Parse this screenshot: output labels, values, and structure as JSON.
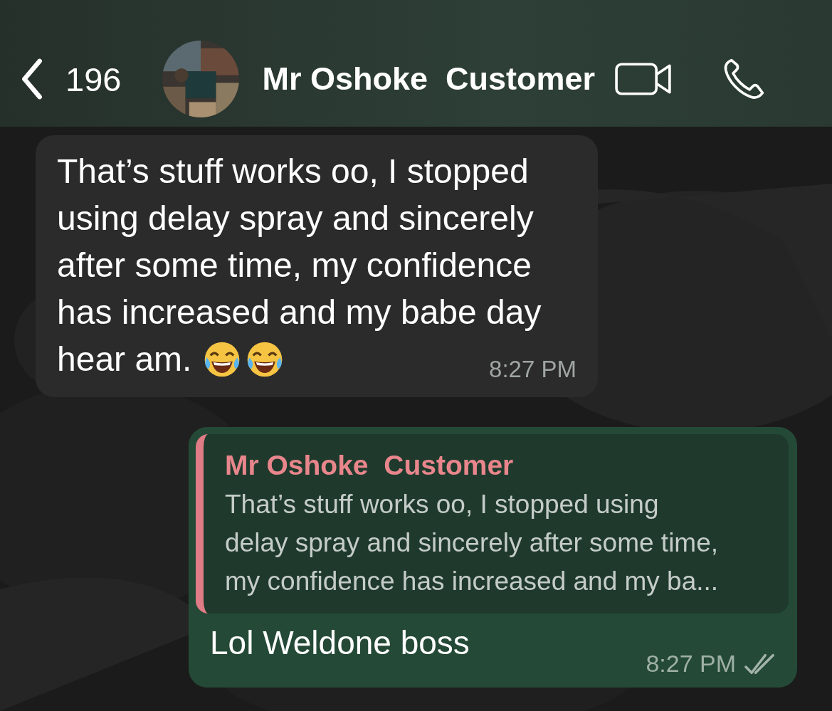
{
  "header": {
    "back_count": "196",
    "contact_name": "Mr Oshoke  Customer"
  },
  "messages": [
    {
      "kind": "incoming",
      "lines": [
        "That’s stuff works oo, I stopped",
        "using delay spray and sincerely",
        "after some time, my confidence",
        "has increased and my babe day",
        "hear am."
      ],
      "time": "8:27 PM"
    },
    {
      "kind": "outgoing",
      "quote": {
        "author": "Mr Oshoke  Customer",
        "lines": [
          "That’s stuff works oo, I stopped using",
          "delay spray and sincerely after some time,",
          "my confidence has increased and my ba..."
        ]
      },
      "text": "Lol Weldone boss",
      "time": "8:27 PM",
      "read": false
    }
  ]
}
